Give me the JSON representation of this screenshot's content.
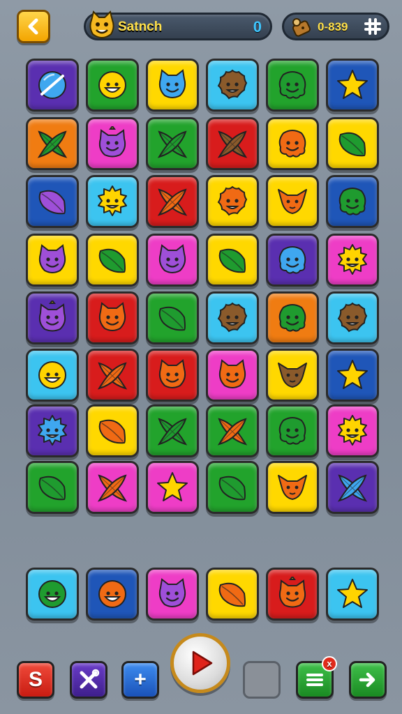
{
  "header": {
    "player_name": "Satnch",
    "score": "0",
    "coins": "0-839"
  },
  "colors": {
    "purple": "#5a2fb0",
    "green": "#22a32c",
    "yellow": "#ffd800",
    "cyan": "#3cc4f0",
    "blue": "#1f56b8",
    "orange": "#f07c12",
    "pink": "#ee3dc6",
    "red": "#d81c1c",
    "icon_green": "#1f9b2f",
    "icon_orange": "#f06a14",
    "icon_purple": "#9e4fd8",
    "icon_blue": "#3fa7ef",
    "icon_brown": "#8a5a2b",
    "icon_yellow": "#ffd400"
  },
  "board": [
    [
      {
        "bg": "purple",
        "icon": "ball-icon",
        "ic": "icon_blue"
      },
      {
        "bg": "green",
        "icon": "smiley-icon",
        "ic": "icon_yellow"
      },
      {
        "bg": "yellow",
        "icon": "cat-face-icon",
        "ic": "icon_blue"
      },
      {
        "bg": "cyan",
        "icon": "fuzzy-monster-icon",
        "ic": "icon_brown"
      },
      {
        "bg": "green",
        "icon": "blob-monster-icon",
        "ic": "icon_green"
      },
      {
        "bg": "blue",
        "icon": "star-icon",
        "ic": "icon_yellow"
      }
    ],
    [
      {
        "bg": "orange",
        "icon": "crossed-leaves-icon",
        "ic": "icon_green"
      },
      {
        "bg": "pink",
        "icon": "horned-cat-icon",
        "ic": "icon_purple"
      },
      {
        "bg": "green",
        "icon": "crossed-leaves-icon",
        "ic": "icon_green"
      },
      {
        "bg": "red",
        "icon": "crossed-leaves-icon",
        "ic": "icon_brown"
      },
      {
        "bg": "yellow",
        "icon": "blob-monster-icon",
        "ic": "icon_orange"
      },
      {
        "bg": "yellow",
        "icon": "leaf-icon",
        "ic": "icon_green"
      }
    ],
    [
      {
        "bg": "blue",
        "icon": "leaf-icon",
        "ic": "icon_purple"
      },
      {
        "bg": "cyan",
        "icon": "spiky-monster-icon",
        "ic": "icon_yellow"
      },
      {
        "bg": "red",
        "icon": "crossed-leaves-icon",
        "ic": "icon_orange"
      },
      {
        "bg": "yellow",
        "icon": "fuzzy-monster-icon",
        "ic": "icon_orange"
      },
      {
        "bg": "yellow",
        "icon": "fox-face-icon",
        "ic": "icon_orange"
      },
      {
        "bg": "blue",
        "icon": "blob-monster-icon",
        "ic": "icon_green"
      }
    ],
    [
      {
        "bg": "yellow",
        "icon": "cat-face-icon",
        "ic": "icon_purple"
      },
      {
        "bg": "yellow",
        "icon": "leaf-icon",
        "ic": "icon_green"
      },
      {
        "bg": "pink",
        "icon": "cat-face-icon",
        "ic": "icon_purple"
      },
      {
        "bg": "yellow",
        "icon": "leaf-icon",
        "ic": "icon_green"
      },
      {
        "bg": "purple",
        "icon": "blob-monster-icon",
        "ic": "icon_blue"
      },
      {
        "bg": "pink",
        "icon": "spiky-monster-icon",
        "ic": "icon_yellow"
      }
    ],
    [
      {
        "bg": "purple",
        "icon": "horned-cat-icon",
        "ic": "icon_purple"
      },
      {
        "bg": "red",
        "icon": "cat-face-icon",
        "ic": "icon_orange"
      },
      {
        "bg": "green",
        "icon": "leaf-icon",
        "ic": "icon_green"
      },
      {
        "bg": "cyan",
        "icon": "fuzzy-monster-icon",
        "ic": "icon_brown"
      },
      {
        "bg": "orange",
        "icon": "blob-monster-icon",
        "ic": "icon_green"
      },
      {
        "bg": "cyan",
        "icon": "fuzzy-monster-icon",
        "ic": "icon_brown"
      }
    ],
    [
      {
        "bg": "cyan",
        "icon": "smiley-icon",
        "ic": "icon_yellow"
      },
      {
        "bg": "red",
        "icon": "crossed-leaves-icon",
        "ic": "icon_orange"
      },
      {
        "bg": "red",
        "icon": "cat-face-icon",
        "ic": "icon_orange"
      },
      {
        "bg": "pink",
        "icon": "cat-face-icon",
        "ic": "icon_orange"
      },
      {
        "bg": "yellow",
        "icon": "fox-face-icon",
        "ic": "icon_brown"
      },
      {
        "bg": "blue",
        "icon": "star-icon",
        "ic": "icon_yellow"
      }
    ],
    [
      {
        "bg": "purple",
        "icon": "spiky-monster-icon",
        "ic": "icon_blue"
      },
      {
        "bg": "yellow",
        "icon": "leaf-icon",
        "ic": "icon_orange"
      },
      {
        "bg": "green",
        "icon": "crossed-leaves-icon",
        "ic": "icon_green"
      },
      {
        "bg": "green",
        "icon": "crossed-leaves-icon",
        "ic": "icon_orange"
      },
      {
        "bg": "green",
        "icon": "blob-monster-icon",
        "ic": "icon_green"
      },
      {
        "bg": "pink",
        "icon": "spiky-monster-icon",
        "ic": "icon_yellow"
      }
    ],
    [
      {
        "bg": "green",
        "icon": "leaf-icon",
        "ic": "icon_green"
      },
      {
        "bg": "pink",
        "icon": "crossed-leaves-icon",
        "ic": "icon_orange"
      },
      {
        "bg": "pink",
        "icon": "star-icon",
        "ic": "icon_yellow"
      },
      {
        "bg": "green",
        "icon": "leaf-icon",
        "ic": "icon_green"
      },
      {
        "bg": "yellow",
        "icon": "fox-face-icon",
        "ic": "icon_orange"
      },
      {
        "bg": "purple",
        "icon": "crossed-leaves-icon",
        "ic": "icon_blue"
      }
    ]
  ],
  "tray": [
    {
      "bg": "cyan",
      "icon": "smiley-icon",
      "ic": "icon_green"
    },
    {
      "bg": "blue",
      "icon": "smiley-icon",
      "ic": "icon_orange"
    },
    {
      "bg": "pink",
      "icon": "cat-face-icon",
      "ic": "icon_purple"
    },
    {
      "bg": "yellow",
      "icon": "leaf-icon",
      "ic": "icon_orange"
    },
    {
      "bg": "red",
      "icon": "horned-cat-icon",
      "ic": "icon_orange"
    },
    {
      "bg": "cyan",
      "icon": "star-icon",
      "ic": "icon_yellow"
    }
  ],
  "toolbar": {
    "s_label": "S",
    "plus_label": "+",
    "notification_badge": "x"
  }
}
